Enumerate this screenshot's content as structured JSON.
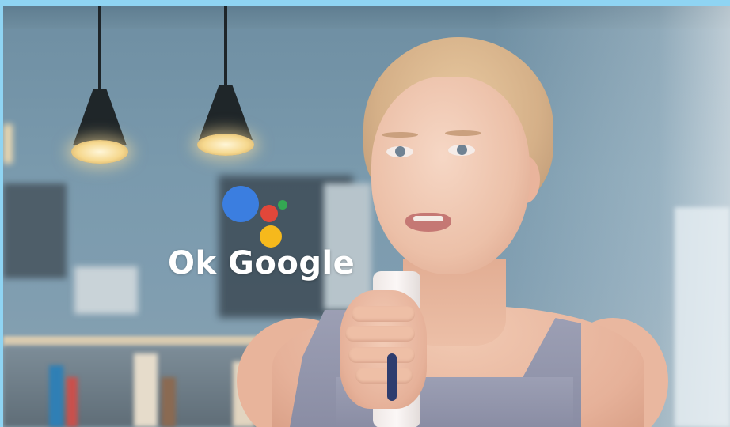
{
  "branding": {
    "logo": "google-assistant-dots",
    "dot_colors": {
      "blue": "#3b7ee0",
      "red": "#e2473a",
      "green": "#34a853",
      "yellow": "#f6b91c"
    },
    "caption": "Ok Google"
  },
  "colors": {
    "frame_border": "#8fd4f3",
    "wall": "#7a9aad"
  }
}
